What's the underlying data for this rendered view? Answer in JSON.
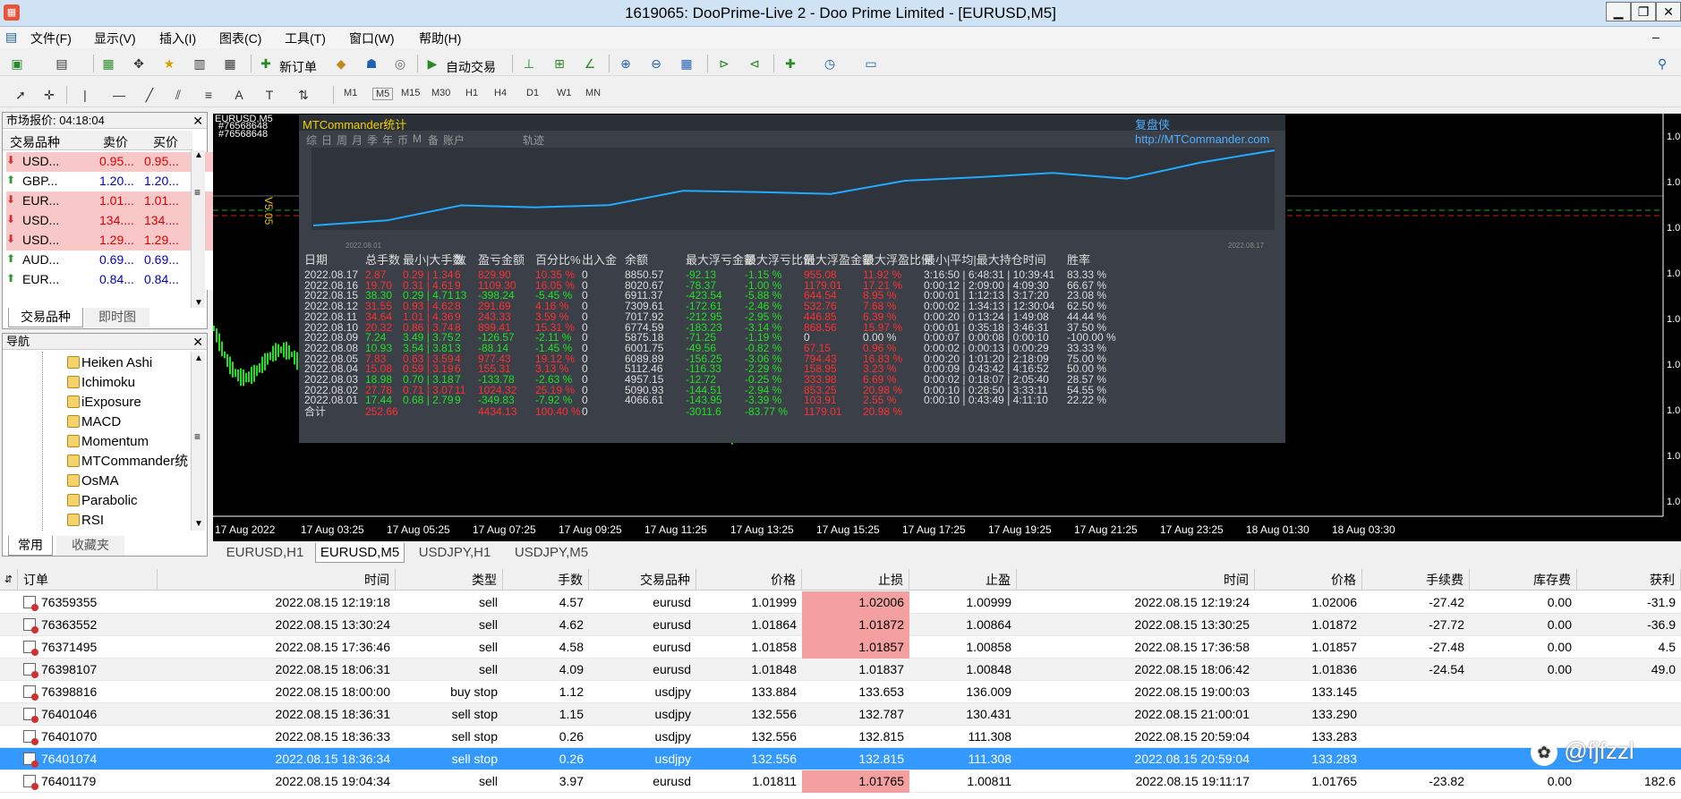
{
  "window": {
    "title": "1619065: DooPrime-Live 2 - Doo Prime Limited - [EURUSD,M5]",
    "min": "▁",
    "max": "❐",
    "close": "✕"
  },
  "menu": [
    "文件(F)",
    "显示(V)",
    "插入(I)",
    "图表(C)",
    "工具(T)",
    "窗口(W)",
    "帮助(H)"
  ],
  "toolbar": {
    "new_order": "新订单",
    "auto_trade": "自动交易",
    "timeframes": [
      "M1",
      "M5",
      "M15",
      "M30",
      "H1",
      "H4",
      "D1",
      "W1",
      "MN"
    ]
  },
  "market_watch": {
    "title": "市场报价: 04:18:04",
    "cols": [
      "交易品种",
      "卖价",
      "买价"
    ],
    "rows": [
      {
        "sym": "USD...",
        "bid": "0.95...",
        "ask": "0.95...",
        "dir": "down"
      },
      {
        "sym": "GBP...",
        "bid": "1.20...",
        "ask": "1.20...",
        "dir": "up"
      },
      {
        "sym": "EUR...",
        "bid": "1.01...",
        "ask": "1.01...",
        "dir": "down"
      },
      {
        "sym": "USD...",
        "bid": "134....",
        "ask": "134....",
        "dir": "down"
      },
      {
        "sym": "USD...",
        "bid": "1.29...",
        "ask": "1.29...",
        "dir": "down"
      },
      {
        "sym": "AUD...",
        "bid": "0.69...",
        "ask": "0.69...",
        "dir": "up"
      },
      {
        "sym": "EUR...",
        "bid": "0.84...",
        "ask": "0.84...",
        "dir": "up"
      }
    ],
    "tabs": [
      "交易品种",
      "即时图"
    ]
  },
  "navigator": {
    "title": "导航",
    "items": [
      "Heiken Ashi",
      "Ichimoku",
      "iExposure",
      "MACD",
      "Momentum",
      "MTCommander统",
      "OsMA",
      "Parabolic",
      "RSI"
    ],
    "tabs": [
      "常用",
      "收藏夹"
    ]
  },
  "chart": {
    "symbol_label": "EURUSD,M5",
    "order_ids": [
      "#76568648",
      "#76568648"
    ],
    "price_labels": [
      "1.0",
      "1.0",
      "1.0",
      "1.0",
      "1.0",
      "1.0",
      "1.0",
      "1.0",
      "1.0"
    ],
    "times": [
      "17 Aug 2022",
      "17 Aug 03:25",
      "17 Aug 05:25",
      "17 Aug 07:25",
      "17 Aug 09:25",
      "17 Aug 11:25",
      "17 Aug 13:25",
      "17 Aug 15:25",
      "17 Aug 17:25",
      "17 Aug 19:25",
      "17 Aug 21:25",
      "17 Aug 23:25",
      "18 Aug 01:30",
      "18 Aug 03:30"
    ],
    "version": "V5.05"
  },
  "mtc": {
    "title": "MTCommander统计",
    "brand": "复盘侠 http://MTCommander.com",
    "tabs": [
      "综",
      "日",
      "周",
      "月",
      "季",
      "年",
      "币",
      "M",
      "备",
      "账户",
      "轨迹"
    ],
    "curve_start": "2022.08.01",
    "curve_end": "2022.08.17",
    "cols": [
      "日期",
      "总手数",
      "最小|大手数",
      "数",
      "盈亏金额",
      "百分比%",
      "出入金",
      "余额",
      "最大浮亏金额",
      "最大浮亏比例",
      "最大浮盈金额",
      "最大浮盈比例",
      "最小|平均|最大持仓时间",
      "胜率"
    ],
    "rows": [
      [
        "2022.08.17",
        "2.87",
        "0.29 | 1.34",
        "6",
        "829.90",
        "10.35 %",
        "0",
        "8850.57",
        "-92.13",
        "-1.15 %",
        "955.08",
        "11.92 %",
        "3:16:50 | 6:48:31 | 10:39:41",
        "83.33 %"
      ],
      [
        "2022.08.16",
        "19.70",
        "0.31 | 4.61",
        "9",
        "1109.30",
        "16.05 %",
        "0",
        "8020.67",
        "-78.37",
        "-1.00 %",
        "1179.01",
        "17.21 %",
        "0:00:12 | 2:09:00 | 4:09:30",
        "66.67 %"
      ],
      [
        "2022.08.15",
        "38.30",
        "0.29 | 4.71",
        "13",
        "-398.24",
        "-5.45 %",
        "0",
        "6911.37",
        "-423.54",
        "-5.88 %",
        "644.54",
        "8.95 %",
        "0:00:01 | 1:12:13 | 3:17:20",
        "23.08 %"
      ],
      [
        "2022.08.12",
        "31.55",
        "0.93 | 4.62",
        "8",
        "291.69",
        "4.16 %",
        "0",
        "7309.61",
        "-172.61",
        "-2.46 %",
        "532.76",
        "7.68 %",
        "0:00:02 | 1:34:13 | 12:30:04",
        "62.50 %"
      ],
      [
        "2022.08.11",
        "34.64",
        "1.01 | 4.36",
        "9",
        "243.33",
        "3.59 %",
        "0",
        "7017.92",
        "-212.95",
        "-2.95 %",
        "446.85",
        "6.39 %",
        "0:00:20 | 0:13:24 | 1:49:08",
        "44.44 %"
      ],
      [
        "2022.08.10",
        "20.32",
        "0.86 | 3.74",
        "8",
        "899.41",
        "15.31 %",
        "0",
        "6774.59",
        "-183.23",
        "-3.14 %",
        "868.56",
        "15.97 %",
        "0:00:01 | 0:35:18 | 3:46:31",
        "37.50 %"
      ],
      [
        "2022.08.09",
        "7.24",
        "3.49 | 3.75",
        "2",
        "-126.57",
        "-2.11 %",
        "0",
        "5875.18",
        "-71.25",
        "-1.19 %",
        "0",
        "0.00 %",
        "0:00:07 | 0:00:08 | 0:00:10",
        "-100.00 %"
      ],
      [
        "2022.08.08",
        "10.93",
        "3.54 | 3.81",
        "3",
        "-88.14",
        "-1.45 %",
        "0",
        "6001.75",
        "-49.56",
        "-0.82 %",
        "67.15",
        "0.96 %",
        "0:00:02 | 0:00:13 | 0:00:29",
        "33.33 %"
      ],
      [
        "2022.08.05",
        "7.83",
        "0.63 | 3.59",
        "4",
        "977.43",
        "19.12 %",
        "0",
        "6089.89",
        "-156.25",
        "-3.06 %",
        "794.43",
        "16.83 %",
        "0:00:20 | 1:01:20 | 2:18:09",
        "75.00 %"
      ],
      [
        "2022.08.04",
        "15.08",
        "0.59 | 3.19",
        "6",
        "155.31",
        "3.13 %",
        "0",
        "5112.46",
        "-116.33",
        "-2.29 %",
        "158.95",
        "3.23 %",
        "0:00:09 | 0:43:42 | 4:16:52",
        "50.00 %"
      ],
      [
        "2022.08.03",
        "18.98",
        "0.70 | 3.18",
        "7",
        "-133.78",
        "-2.63 %",
        "0",
        "4957.15",
        "-12.72",
        "-0.25 %",
        "333.98",
        "6.69 %",
        "0:00:02 | 0:18:07 | 2:05:40",
        "28.57 %"
      ],
      [
        "2022.08.02",
        "27.78",
        "0.71 | 3.07",
        "11",
        "1024.32",
        "25.19 %",
        "0",
        "5090.93",
        "-144.51",
        "-2.94 %",
        "853.25",
        "20.98 %",
        "0:00:10 | 0:28:50 | 3:33:11",
        "54.55 %"
      ],
      [
        "2022.08.01",
        "17.44",
        "0.68 | 2.79",
        "9",
        "-349.83",
        "-7.92 %",
        "0",
        "4066.61",
        "-143.95",
        "-3.39 %",
        "103.91",
        "2.55 %",
        "0:00:10 | 0:43:49 | 4:11:10",
        "22.22 %"
      ]
    ],
    "total": [
      "合计",
      "252.66",
      "",
      "",
      "4434.13",
      "100.40 %",
      "0",
      "",
      "-3011.6",
      "-83.77 %",
      "1179.01",
      "20.98 %",
      "",
      ""
    ]
  },
  "chart_tabs": [
    "EURUSD,H1",
    "EURUSD,M5",
    "USDJPY,H1",
    "USDJPY,M5"
  ],
  "orders": {
    "cols": [
      "订单",
      "时间",
      "类型",
      "手数",
      "交易品种",
      "价格",
      "止损",
      "止盈",
      "时间",
      "价格",
      "手续费",
      "库存费",
      "获利"
    ],
    "rows": [
      [
        "76359355",
        "2022.08.15 12:19:18",
        "sell",
        "4.57",
        "eurusd",
        "1.01999",
        "1.02006",
        "1.00999",
        "2022.08.15 12:19:24",
        "1.02006",
        "-27.42",
        "0.00",
        "-31.9"
      ],
      [
        "76363552",
        "2022.08.15 13:30:24",
        "sell",
        "4.62",
        "eurusd",
        "1.01864",
        "1.01872",
        "1.00864",
        "2022.08.15 13:30:25",
        "1.01872",
        "-27.72",
        "0.00",
        "-36.9"
      ],
      [
        "76371495",
        "2022.08.15 17:36:46",
        "sell",
        "4.58",
        "eurusd",
        "1.01858",
        "1.01857",
        "1.00858",
        "2022.08.15 17:36:58",
        "1.01857",
        "-27.48",
        "0.00",
        "4.5"
      ],
      [
        "76398107",
        "2022.08.15 18:06:31",
        "sell",
        "4.09",
        "eurusd",
        "1.01848",
        "1.01837",
        "1.00848",
        "2022.08.15 18:06:42",
        "1.01836",
        "-24.54",
        "0.00",
        "49.0"
      ],
      [
        "76398816",
        "2022.08.15 18:00:00",
        "buy stop",
        "1.12",
        "usdjpy",
        "133.884",
        "133.653",
        "136.009",
        "2022.08.15 19:00:03",
        "133.145",
        "",
        "",
        ""
      ],
      [
        "76401046",
        "2022.08.15 18:36:31",
        "sell stop",
        "1.15",
        "usdjpy",
        "132.556",
        "132.787",
        "130.431",
        "2022.08.15 21:00:01",
        "133.290",
        "",
        "",
        ""
      ],
      [
        "76401070",
        "2022.08.15 18:36:33",
        "sell stop",
        "0.26",
        "usdjpy",
        "132.556",
        "132.815",
        "111.308",
        "2022.08.15 20:59:04",
        "133.283",
        "",
        "",
        ""
      ],
      [
        "76401074",
        "2022.08.15 18:36:34",
        "sell stop",
        "0.26",
        "usdjpy",
        "132.556",
        "132.815",
        "111.308",
        "2022.08.15 20:59:04",
        "133.283",
        "",
        "",
        ""
      ],
      [
        "76401179",
        "2022.08.15 19:04:34",
        "sell",
        "3.97",
        "eurusd",
        "1.01811",
        "1.01765",
        "1.00811",
        "2022.08.15 19:11:17",
        "1.01765",
        "-23.82",
        "0.00",
        "182.6"
      ]
    ],
    "sl_highlight": [
      true,
      true,
      true,
      false,
      false,
      false,
      false,
      false,
      true
    ],
    "selected_index": 7
  },
  "watermark": "@fjfzzl",
  "colors": {
    "chart_bg": "#000000",
    "curve": "#22aaff",
    "positive": "#22e022",
    "negative": "#ff3030",
    "selected": "#3399ff",
    "sl_highlight": "#f4a0a0"
  }
}
